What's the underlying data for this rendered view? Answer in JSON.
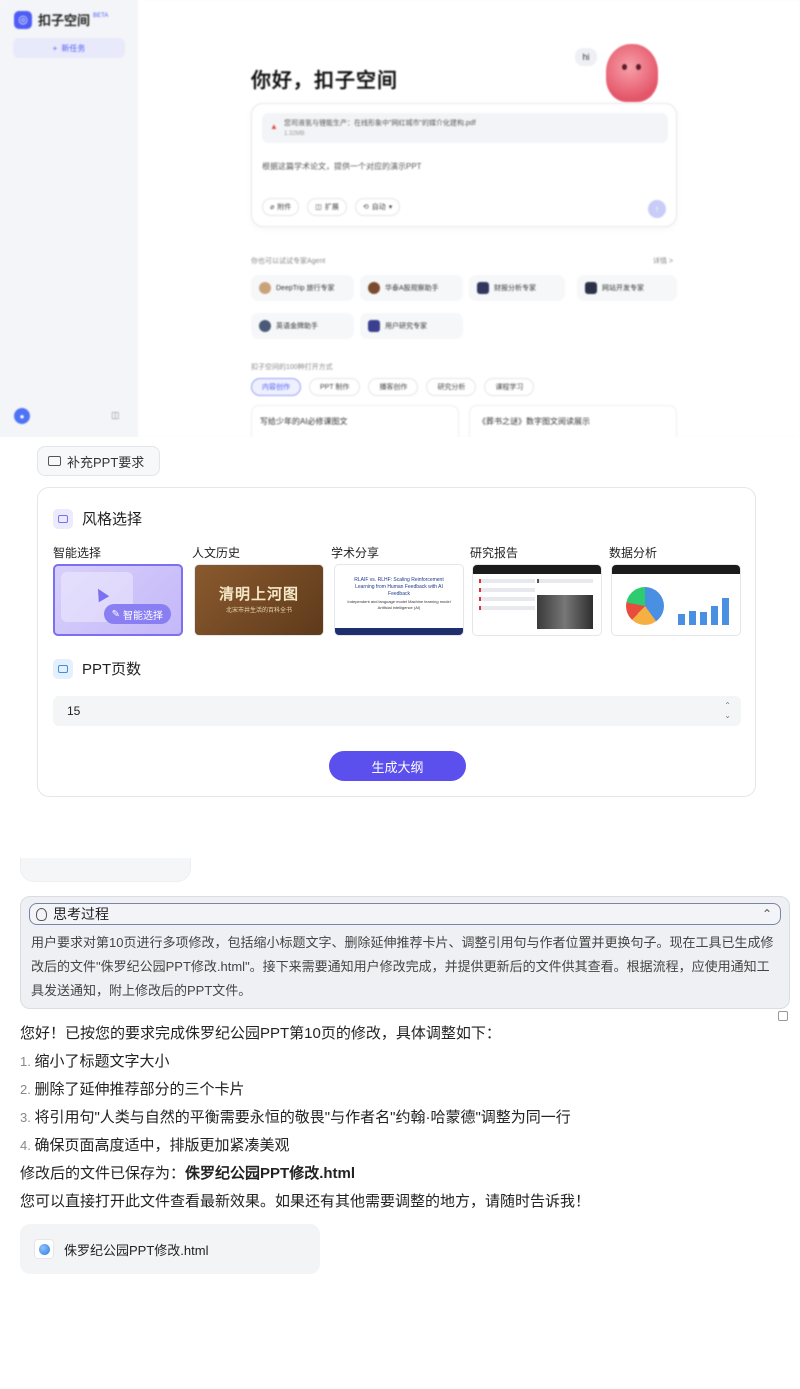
{
  "app": {
    "brand": "扣子空间",
    "brand_badge": "BETA",
    "new_task": "新任务",
    "greeting": "你好，扣子空间",
    "mascot_hi": "hi",
    "attached_file": {
      "name": "您司液氢与锂能生产：在线形象中\"网红城市\"的媒介化建构.pdf",
      "size": "1.32MB"
    },
    "prompt": "根据这篇学术论文，提供一个对应的演示PPT",
    "tools": [
      "附件",
      "扩展",
      "自动"
    ],
    "agents_header": "你也可以试试专家Agent",
    "agents_more": "详情 >",
    "agents": [
      "DeepTrip 旅行专家",
      "华泰A股观察助手",
      "财报分析专家",
      "网站开发专家",
      "英语金牌助手",
      "用户研究专家"
    ],
    "ways_header": "扣子空间的100种打开方式",
    "way_tabs": [
      "内容创作",
      "PPT 制作",
      "播客创作",
      "研究分析",
      "课程学习"
    ],
    "cases": [
      "写给少年的AI必修课图文",
      "《葬书之谜》数字图文阅读展示"
    ]
  },
  "ppt": {
    "supplement_button": "补充PPT要求",
    "style_section": "风格选择",
    "styles": [
      "智能选择",
      "人文历史",
      "学术分享",
      "研究报告",
      "数据分析"
    ],
    "smart_badge": "智能选择",
    "hist_title": "清明上河图",
    "hist_sub": "北宋市井生活的百科全书",
    "acad_title": "RLAIF vs. RLHF: Scaling Reinforcement Learning from Human Feedback with AI Feedback",
    "acad_meta": "Independent and language model\nMachine learning model\nArtificial intelligence (AI)",
    "pages_section": "PPT页数",
    "pages_value": "15",
    "generate_button": "生成大纲"
  },
  "chat": {
    "thinking_title": "思考过程",
    "thinking_body": "用户要求对第10页进行多项修改，包括缩小标题文字、删除延伸推荐卡片、调整引用句与作者位置并更换句子。现在工具已生成修改后的文件\"侏罗纪公园PPT修改.html\"。接下来需要通知用户修改完成，并提供更新后的文件供其查看。根据流程，应使用通知工具发送通知，附上修改后的PPT文件。",
    "intro": "您好！已按您的要求完成侏罗纪公园PPT第10页的修改，具体调整如下：",
    "items": [
      "缩小了标题文字大小",
      "删除了延伸推荐部分的三个卡片",
      "将引用句\"人类与自然的平衡需要永恒的敬畏\"与作者名\"约翰·哈蒙德\"调整为同一行",
      "确保页面高度适中，排版更加紧凑美观"
    ],
    "saved_prefix": "修改后的文件已保存为：",
    "saved_file": "侏罗纪公园PPT修改.html",
    "closing": "您可以直接打开此文件查看最新效果。如果还有其他需要调整的地方，请随时告诉我！",
    "file_card": "侏罗纪公园PPT修改.html"
  }
}
